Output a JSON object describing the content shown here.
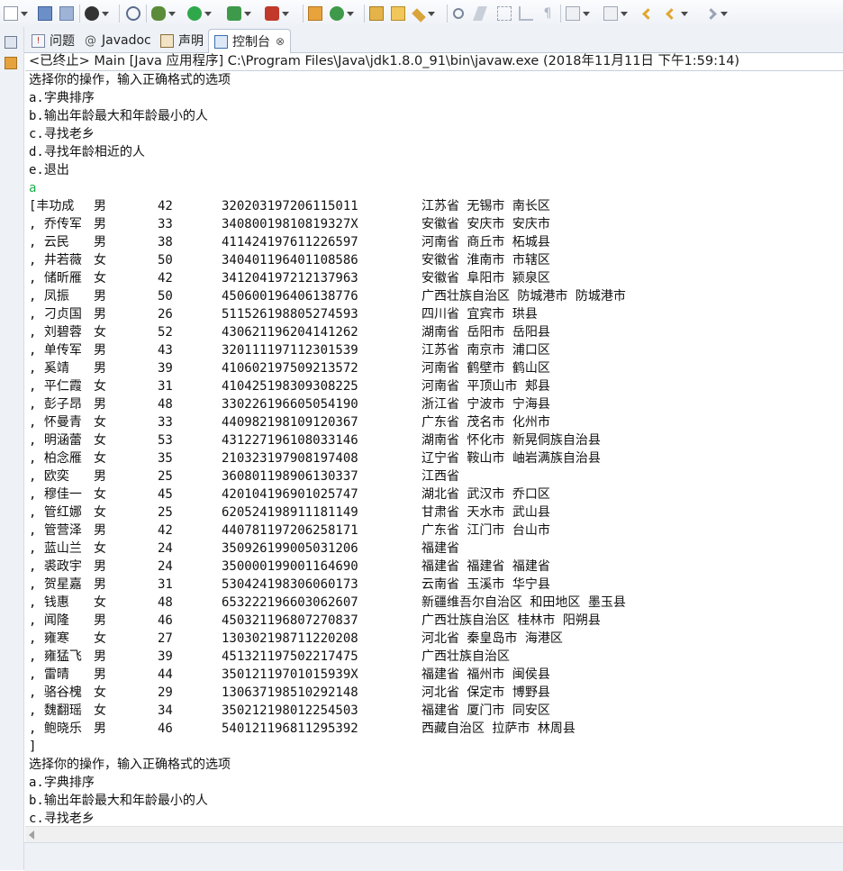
{
  "tabs": [
    {
      "label": "问题",
      "icon": "problems-icon"
    },
    {
      "label": "Javadoc",
      "icon": "javadoc-icon"
    },
    {
      "label": "声明",
      "icon": "declaration-icon"
    },
    {
      "label": "控制台",
      "icon": "console-icon",
      "active": true
    }
  ],
  "close_glyph": "⊗",
  "console_header": "<已终止> Main [Java 应用程序] C:\\Program Files\\Java\\jdk1.8.0_91\\bin\\javaw.exe  (2018年11月11日 下午1:59:14)",
  "menu_lines": [
    "选择你的操作，输入正确格式的选项",
    "a.字典排序",
    "b.输出年龄最大和年龄最小的人",
    "c.寻找老乡",
    "d.寻找年龄相近的人",
    "e.退出"
  ],
  "user_input": "a",
  "rows": [
    {
      "name": "[丰功成",
      "sex": "男",
      "age": "42",
      "id": "320203197206115011",
      "addr": "江苏省 无锡市 南长区"
    },
    {
      "name": ", 乔传军",
      "sex": "男",
      "age": "33",
      "id": "34080019810819327X",
      "addr": "安徽省 安庆市 安庆市"
    },
    {
      "name": ", 云民",
      "sex": "男",
      "age": "38",
      "id": "411424197611226597",
      "addr": "河南省 商丘市 柘城县"
    },
    {
      "name": ", 井若薇",
      "sex": "女",
      "age": "50",
      "id": "340401196401108586",
      "addr": "安徽省 淮南市 市辖区"
    },
    {
      "name": ", 储昕雁",
      "sex": "女",
      "age": "42",
      "id": "341204197212137963",
      "addr": "安徽省 阜阳市 颍泉区"
    },
    {
      "name": ", 凤振",
      "sex": "男",
      "age": "50",
      "id": "450600196406138776",
      "addr": "广西壮族自治区 防城港市 防城港市"
    },
    {
      "name": ", 刁贞国",
      "sex": "男",
      "age": "26",
      "id": "511526198805274593",
      "addr": "四川省 宜宾市 珙县"
    },
    {
      "name": ", 刘碧蓉",
      "sex": "女",
      "age": "52",
      "id": "430621196204141262",
      "addr": "湖南省 岳阳市 岳阳县"
    },
    {
      "name": ", 单传军",
      "sex": "男",
      "age": "43",
      "id": "320111197112301539",
      "addr": "江苏省 南京市 浦口区"
    },
    {
      "name": ", 奚靖",
      "sex": "男",
      "age": "39",
      "id": "410602197509213572",
      "addr": "河南省 鹤壁市 鹤山区"
    },
    {
      "name": ", 平仁霞",
      "sex": "女",
      "age": "31",
      "id": "410425198309308225",
      "addr": "河南省 平顶山市 郏县"
    },
    {
      "name": ", 彭子昂",
      "sex": "男",
      "age": "48",
      "id": "330226196605054190",
      "addr": "浙江省 宁波市 宁海县"
    },
    {
      "name": ", 怀曼青",
      "sex": "女",
      "age": "33",
      "id": "440982198109120367",
      "addr": "广东省 茂名市 化州市"
    },
    {
      "name": ", 明涵蕾",
      "sex": "女",
      "age": "53",
      "id": "431227196108033146",
      "addr": "湖南省 怀化市 新晃侗族自治县"
    },
    {
      "name": ", 柏念雁",
      "sex": "女",
      "age": "35",
      "id": "210323197908197408",
      "addr": "辽宁省 鞍山市 岫岩满族自治县"
    },
    {
      "name": ", 欧奕",
      "sex": "男",
      "age": "25",
      "id": "360801198906130337",
      "addr": "江西省"
    },
    {
      "name": ", 穆佳一",
      "sex": "女",
      "age": "45",
      "id": "420104196901025747",
      "addr": "湖北省 武汉市 乔口区"
    },
    {
      "name": ", 管红娜",
      "sex": "女",
      "age": "25",
      "id": "620524198911181149",
      "addr": "甘肃省 天水市 武山县"
    },
    {
      "name": ", 管营泽",
      "sex": "男",
      "age": "42",
      "id": "440781197206258171",
      "addr": "广东省 江门市 台山市"
    },
    {
      "name": ", 蓝山兰",
      "sex": "女",
      "age": "24",
      "id": "350926199005031206",
      "addr": "福建省"
    },
    {
      "name": ", 裘政宇",
      "sex": "男",
      "age": "24",
      "id": "350000199001164690",
      "addr": "福建省 福建省 福建省"
    },
    {
      "name": ", 贺星嘉",
      "sex": "男",
      "age": "31",
      "id": "530424198306060173",
      "addr": "云南省 玉溪市 华宁县"
    },
    {
      "name": ", 钱惠",
      "sex": "女",
      "age": "48",
      "id": "653222196603062607",
      "addr": "新疆维吾尔自治区 和田地区 墨玉县"
    },
    {
      "name": ", 闻隆",
      "sex": "男",
      "age": "46",
      "id": "450321196807270837",
      "addr": "广西壮族自治区 桂林市 阳朔县"
    },
    {
      "name": ", 雍寒",
      "sex": "女",
      "age": "27",
      "id": "130302198711220208",
      "addr": "河北省 秦皇岛市 海港区"
    },
    {
      "name": ", 雍猛飞",
      "sex": "男",
      "age": "39",
      "id": "451321197502217475",
      "addr": "广西壮族自治区"
    },
    {
      "name": ", 雷晴",
      "sex": "男",
      "age": "44",
      "id": "35012119701015939X",
      "addr": "福建省 福州市 闽侯县"
    },
    {
      "name": ", 骆谷槐",
      "sex": "女",
      "age": "29",
      "id": "130637198510292148",
      "addr": "河北省 保定市 博野县"
    },
    {
      "name": ", 魏翻瑶",
      "sex": "女",
      "age": "34",
      "id": "350212198012254503",
      "addr": "福建省 厦门市 同安区"
    },
    {
      "name": ", 鲍晓乐",
      "sex": "男",
      "age": "46",
      "id": "540121196811295392",
      "addr": "西藏自治区 拉萨市 林周县"
    }
  ],
  "list_end": "]",
  "menu_lines_repeat": [
    "选择你的操作，输入正确格式的选项",
    "a.字典排序",
    "b.输出年龄最大和年龄最小的人",
    "c.寻找老乡"
  ],
  "colors": {
    "input_text": "#20b050",
    "active_tab_icon": "#3a6fb0"
  }
}
